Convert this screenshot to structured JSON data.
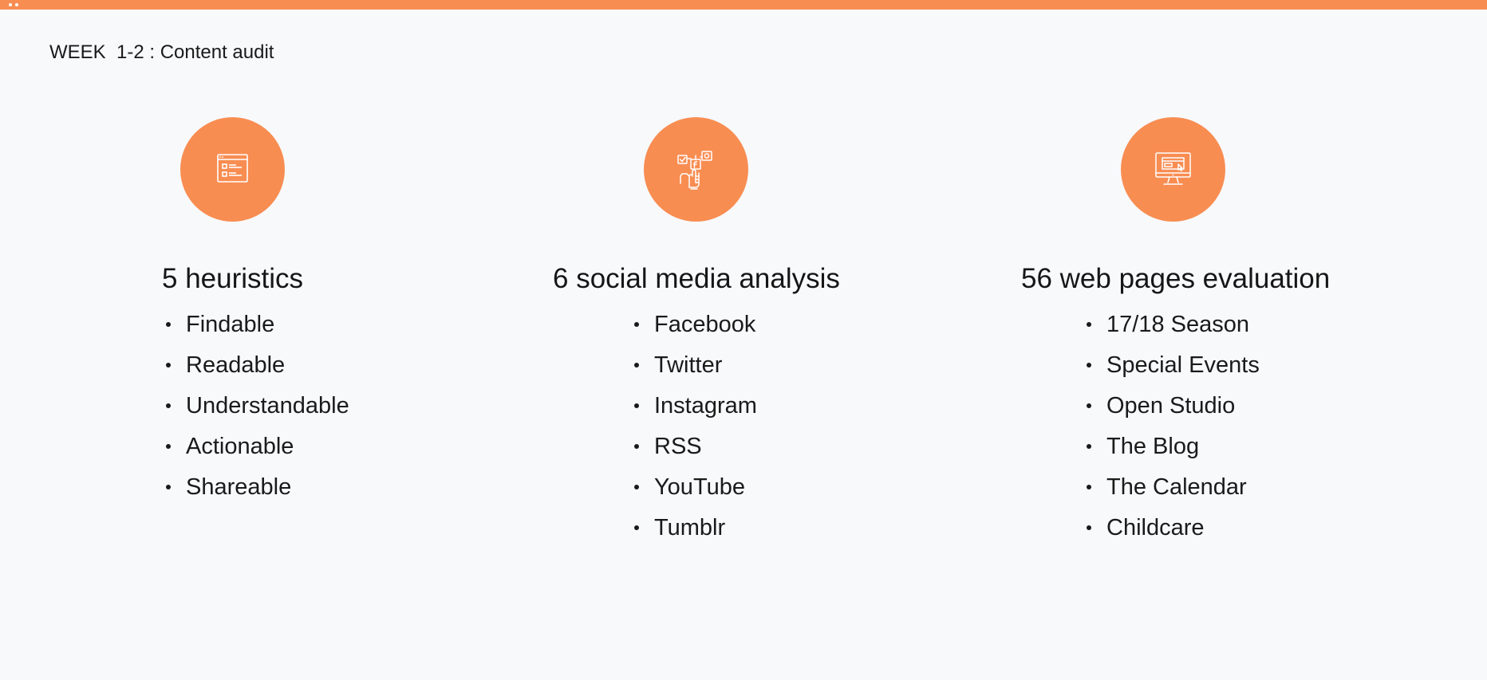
{
  "page": {
    "title": "WEEK  1-2 : Content audit",
    "accent_color": "#f88d52",
    "background_color": "#f8f9fb"
  },
  "columns": [
    {
      "icon": "checklist-window-icon",
      "heading": "5 heuristics",
      "items": [
        "Findable",
        "Readable",
        "Understandable",
        "Actionable",
        "Shareable"
      ]
    },
    {
      "icon": "social-media-hand-icon",
      "heading": "6 social media analysis",
      "items": [
        "Facebook",
        "Twitter",
        "Instagram",
        "RSS",
        "YouTube",
        "Tumblr"
      ]
    },
    {
      "icon": "web-page-monitor-icon",
      "heading": "56 web pages evaluation",
      "items": [
        "17/18 Season",
        "Special Events",
        "Open Studio",
        "The Blog",
        "The Calendar",
        "Childcare"
      ]
    }
  ]
}
